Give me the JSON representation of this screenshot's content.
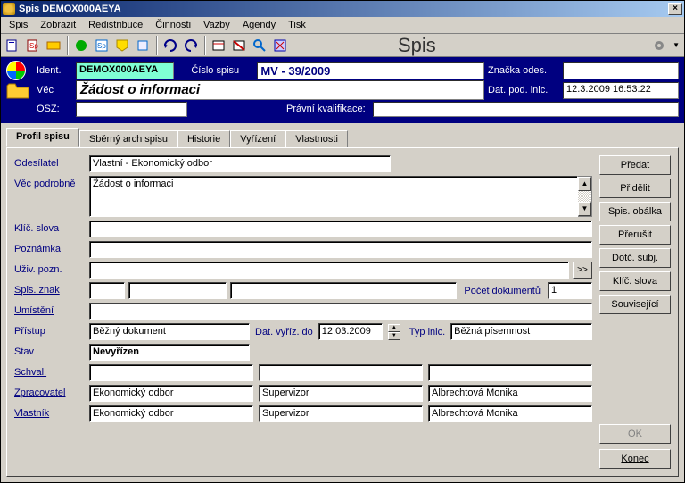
{
  "window": {
    "title": "Spis DEMOX000AEYA"
  },
  "menu": {
    "spis": "Spis",
    "zobrazit": "Zobrazit",
    "redistribuce": "Redistribuce",
    "cinnosti": "Činnosti",
    "vazby": "Vazby",
    "agendy": "Agendy",
    "tisk": "Tisk"
  },
  "toolbar": {
    "title": "Spis"
  },
  "header": {
    "ident_label": "Ident.",
    "ident_value": "DEMOX000AEYA",
    "cislo_label": "Číslo spisu",
    "cislo_value": "MV -  39/2009",
    "znacka_label": "Značka odes.",
    "znacka_value": "",
    "vec_label": "Věc",
    "vec_value": "Žádost o informaci",
    "datpod_label": "Dat. pod. inic.",
    "datpod_value": "12.3.2009 16:53:22",
    "osz_label": "OSZ:",
    "osz_value": "",
    "pravni_label": "Právní kvalifikace:",
    "pravni_value": ""
  },
  "tabs": {
    "profil": "Profil spisu",
    "sberny": "Sběrný arch spisu",
    "historie": "Historie",
    "vyrizeni": "Vyřízení",
    "vlastnosti": "Vlastnosti"
  },
  "form": {
    "odesilatel_label": "Odesílatel",
    "odesilatel_value": "Vlastní - Ekonomický odbor",
    "vecpod_label": "Věc podrobně",
    "vecpod_value": "Žádost o informaci",
    "klic_label": "Klíč. slova",
    "klic_value": "",
    "pozn_label": "Poznámka",
    "pozn_value": "",
    "uziv_label": "Uživ. pozn.",
    "uziv_value": "",
    "spisznak_label": "Spis. znak",
    "pocetdok_label": "Počet dokumentů",
    "pocetdok_value": "1",
    "umisteni_label": "Umístění",
    "umisteni_value": "",
    "pristup_label": "Přístup",
    "pristup_value": "Běžný dokument",
    "datvyriz_label": "Dat. vyříz. do",
    "datvyriz_value": "12.03.2009",
    "typinic_label": "Typ inic.",
    "typinic_value": "Běžná písemnost",
    "stav_label": "Stav",
    "stav_value": "Nevyřízen",
    "schval_label": "Schval.",
    "zprac_label": "Zpracovatel",
    "zprac_1": "Ekonomický odbor",
    "zprac_2": "Supervizor",
    "zprac_3": "Albrechtová Monika",
    "vlast_label": "Vlastník",
    "vlast_1": "Ekonomický odbor",
    "vlast_2": "Supervizor",
    "vlast_3": "Albrechtová Monika"
  },
  "buttons": {
    "predat": "Předat",
    "pridelit": "Přidělit",
    "spisobalka": "Spis. obálka",
    "prerusit": "Přerušit",
    "dotcsubj": "Dotč. subj.",
    "klicslova": "Klíč. slova",
    "souvisejici": "Související",
    "ok": "OK",
    "konec": "Konec",
    "more": ">>"
  }
}
